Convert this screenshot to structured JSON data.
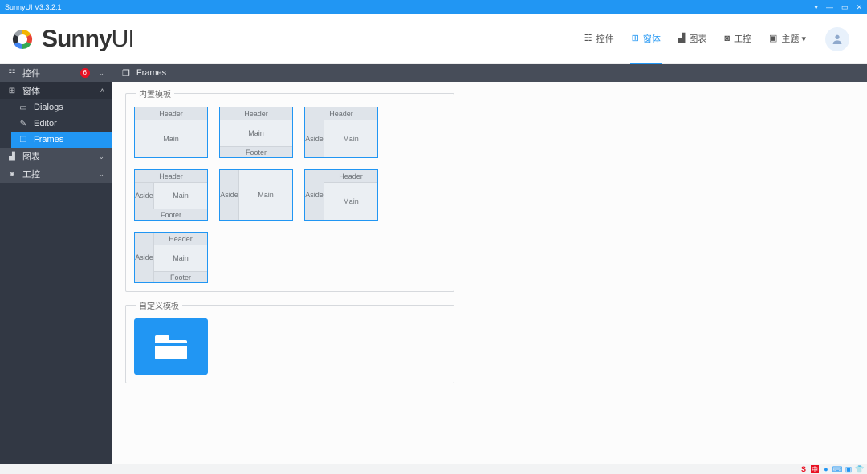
{
  "window": {
    "title": "SunnyUI V3.3.2.1"
  },
  "brand": {
    "logo_prefix": "Sunny",
    "logo_suffix": "UI"
  },
  "header_tabs": [
    {
      "icon": "grid-icon",
      "label": "控件"
    },
    {
      "icon": "windows-icon",
      "label": "窗体",
      "active": true
    },
    {
      "icon": "chart-icon",
      "label": "图表"
    },
    {
      "icon": "camera-icon",
      "label": "工控"
    },
    {
      "icon": "image-icon",
      "label": "主题 ▾"
    }
  ],
  "sidebar": {
    "groups": [
      {
        "icon": "grid-icon",
        "label": "控件",
        "badge": "6",
        "caret": "⌄"
      },
      {
        "icon": "windows-icon",
        "label": "窗体",
        "caret": "˄",
        "children": [
          {
            "icon": "dialog-icon",
            "label": "Dialogs"
          },
          {
            "icon": "edit-icon",
            "label": "Editor"
          },
          {
            "icon": "frames-icon",
            "label": "Frames",
            "selected": true
          }
        ]
      },
      {
        "icon": "chart-icon",
        "label": "图表",
        "caret": "⌄"
      },
      {
        "icon": "camera-icon",
        "label": "工控",
        "caret": "⌄"
      }
    ]
  },
  "content": {
    "page_title": "Frames",
    "group1_title": "内置模板",
    "group2_title": "自定义模板",
    "labels": {
      "header": "Header",
      "footer": "Footer",
      "aside": "Aside",
      "main": "Main"
    }
  }
}
